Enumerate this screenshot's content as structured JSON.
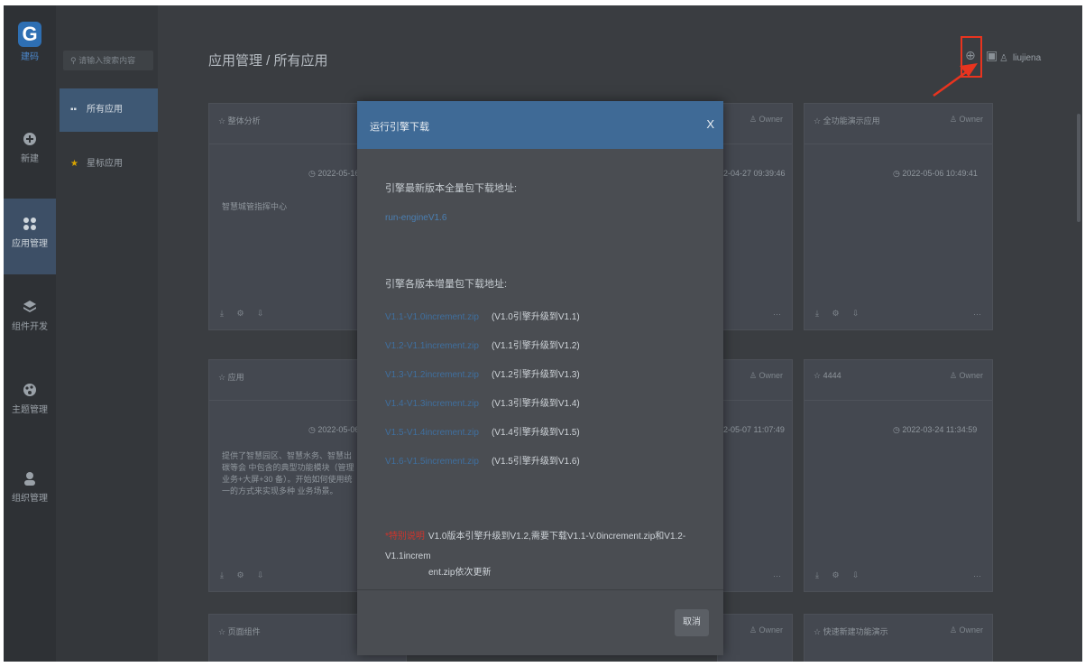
{
  "logo": {
    "text": "建码"
  },
  "rail": [
    {
      "label": "新建",
      "icon": "plus-circle-icon"
    },
    {
      "label": "应用管理",
      "icon": "grid-icon"
    },
    {
      "label": "组件开发",
      "icon": "layers-icon"
    },
    {
      "label": "主题管理",
      "icon": "palette-icon"
    },
    {
      "label": "组织管理",
      "icon": "user-icon"
    }
  ],
  "sidebar": {
    "search_placeholder": "请输入搜索内容",
    "items": [
      {
        "label": "所有应用",
        "icon": "grid-small-icon"
      },
      {
        "label": "星标应用",
        "icon": "star-icon"
      }
    ]
  },
  "header": {
    "breadcrumb": "应用管理 / 所有应用",
    "user": "liujiena"
  },
  "cards": [
    {
      "title": "☆ 整体分析",
      "date": "◷ 2022-05-16 1",
      "desc": "智慧城管指挥中心",
      "footer": "⤓ ⚙ ⇩"
    },
    {
      "title": "",
      "owner": "♙ Owner",
      "date": "2-04-27 09:39:46",
      "footer": ""
    },
    {
      "title": "☆ 全功能演示应用",
      "owner": "♙ Owner",
      "date": "◷ 2022-05-06 10:49:41",
      "footer": "⤓ ⚙ ⇩",
      "more": "···"
    },
    {
      "title": "☆ 应用",
      "date": "◷ 2022-05-06 1",
      "desc": "提供了智慧园区、智慧水务、智慧出碳等会 中包含的典型功能模块（管理业务+大屏+30 备）。开始如何使用统一的方式来实现多种 业务场景。",
      "footer": "⤓ ⚙ ⇩"
    },
    {
      "title": "",
      "owner": "♙ Owner",
      "date": "2-05-07 11:07:49",
      "footer": ""
    },
    {
      "title": "☆ 4444",
      "owner": "♙ Owner",
      "date": "◷ 2022-03-24 11:34:59",
      "footer": "⤓ ⚙ ⇩",
      "more": "···"
    },
    {
      "title": "☆ 页面组件",
      "footer": ""
    },
    {
      "title": "",
      "owner": "♙ Owner"
    },
    {
      "title": "☆ 快速新建功能演示",
      "owner": "♙ Owner"
    }
  ],
  "modal": {
    "title": "运行引擎下载",
    "close": "X",
    "full_label": "引擎最新版本全量包下载地址:",
    "full_link": "run-engineV1.6",
    "inc_label": "引擎各版本增量包下载地址:",
    "increments": [
      {
        "link": "V1.1-V1.0increment.zip",
        "desc": "(V1.0引擎升级到V1.1)"
      },
      {
        "link": "V1.2-V1.1increment.zip",
        "desc": "(V1.1引擎升级到V1.2)"
      },
      {
        "link": "V1.3-V1.2increment.zip",
        "desc": "(V1.2引擎升级到V1.3)"
      },
      {
        "link": "V1.4-V1.3increment.zip",
        "desc": "(V1.3引擎升级到V1.4)"
      },
      {
        "link": "V1.5-V1.4increment.zip",
        "desc": "(V1.4引擎升级到V1.5)"
      },
      {
        "link": "V1.6-V1.5increment.zip",
        "desc": "(V1.5引擎升级到V1.6)"
      }
    ],
    "note_tag": "*特别说明",
    "note_l1": "V1.0版本引擎升级到V1.2,需要下载V1.1-V.0increment.zip和V1.2-V1.1increm",
    "note_l2": "ent.zip依次更新",
    "cancel": "取消"
  },
  "colors": {
    "accent": "#3f6a96",
    "highlight": "#e8341f",
    "note_red": "#d0342c"
  }
}
